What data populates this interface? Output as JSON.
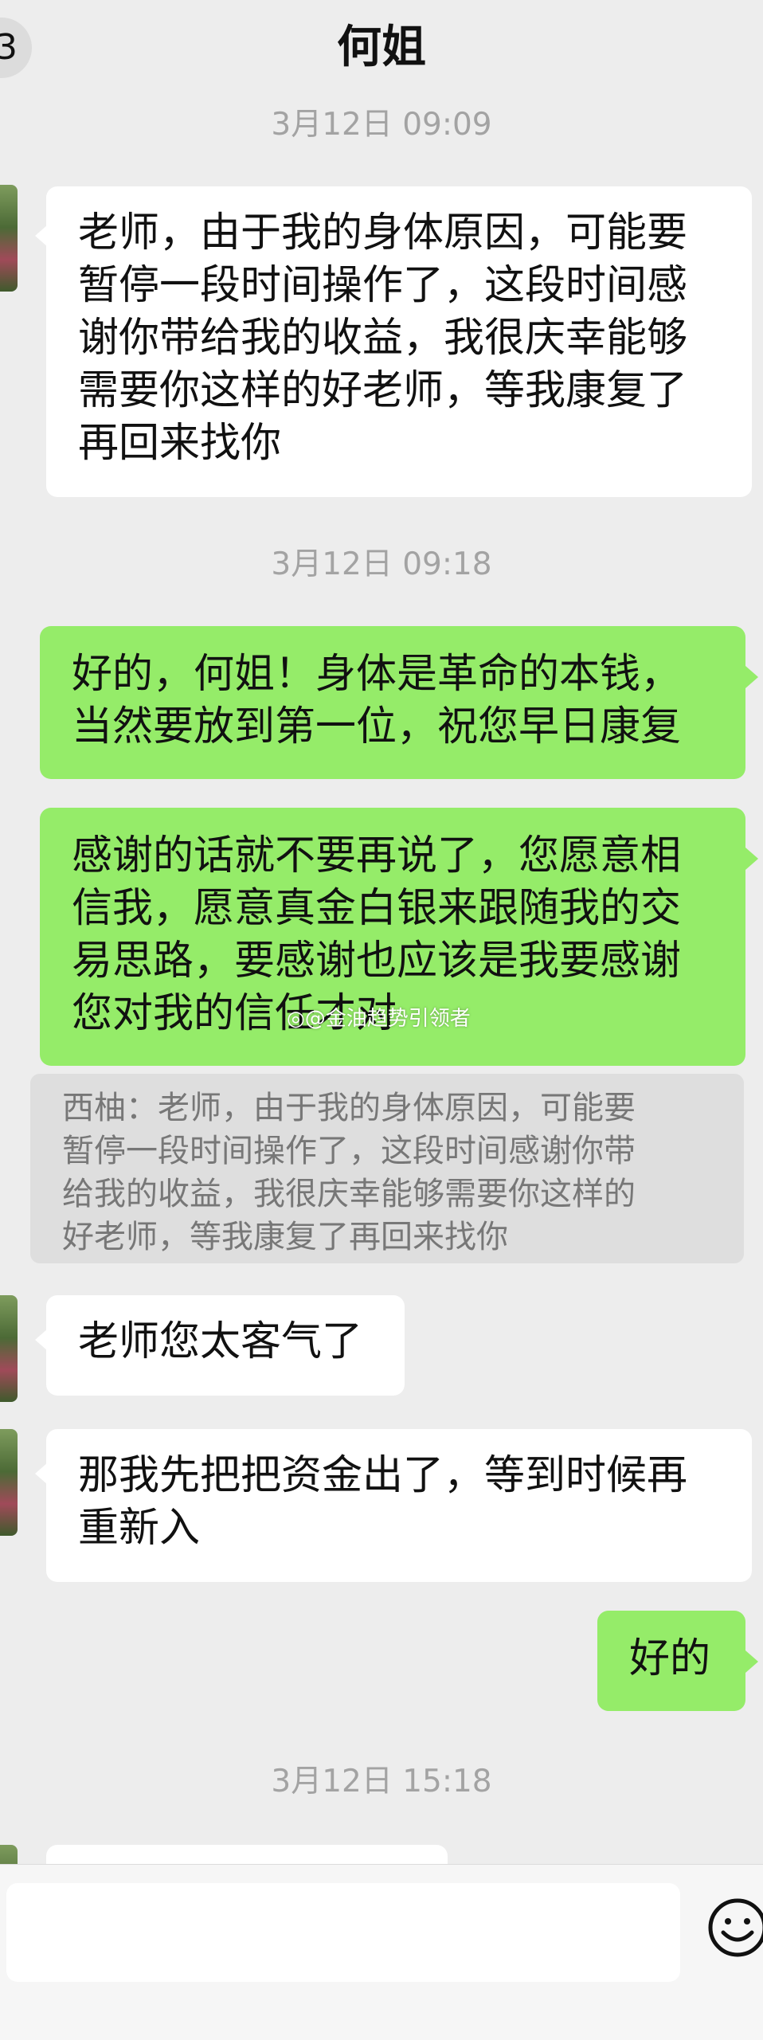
{
  "header": {
    "back_badge": "3",
    "title": "何姐"
  },
  "messages": {
    "ts1": "3月12日 09:09",
    "m1": "老师，由于我的身体原因，可能要\n暂停一段时间操作了，这段时间感\n谢你带给我的收益，我很庆幸能够\n需要你这样的好老师，等我康复了\n再回来找你",
    "ts2": "3月12日 09:18",
    "m2": "好的，何姐！身体是革命的本钱，\n当然要放到第一位，祝您早日康复",
    "m3": "感谢的话就不要再说了，您愿意相\n信我，愿意真金白银来跟随我的交\n易思路，要感谢也应该是我要感谢\n您对我的信任才对",
    "quote": "西柚：老师，由于我的身体原因，可能要\n暂停一段时间操作了，这段时间感谢你带\n给我的收益，我很庆幸能够需要你这样的\n好老师，等我康复了再回来找你",
    "m4": "老师您太客气了",
    "m5": "那我先把把资金出了，等到时候再\n重新入",
    "m6": "好的",
    "ts3": "3月12日 15:18"
  },
  "watermark": "@金油趋势引领者",
  "footer": {
    "input_value": ""
  },
  "colors": {
    "background": "#ededed",
    "outgoing_bubble": "#95ec69",
    "incoming_bubble": "#ffffff",
    "timestamp": "#a3a3a3"
  }
}
